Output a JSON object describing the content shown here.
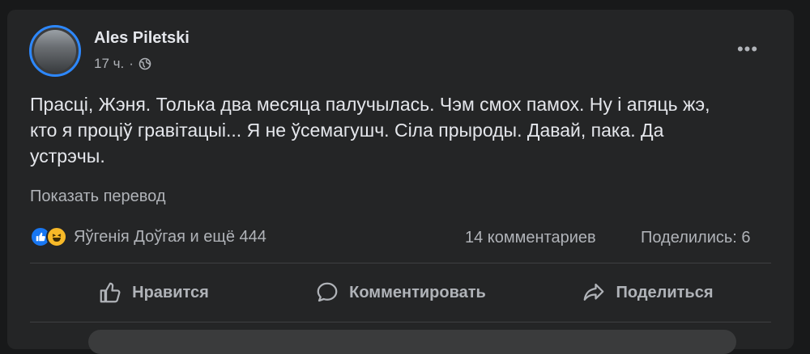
{
  "post": {
    "author": "Ales Piletski",
    "time": "17 ч.",
    "separator": "·",
    "more_label": "•••",
    "body": "Прасці, Жэня. Толька два месяца палучылась. Чэм смох памох. Ну і апяць жэ,\nкто я проціў гравітацыі... Я не ўсемагушч. Сіла прыроды. Давай, пака. Да\nустрэчы.",
    "translate_link": "Показать перевод"
  },
  "reactions": {
    "icons": [
      "like-icon",
      "haha-icon"
    ],
    "summary": "Яўгенія Доўгая и ещё 444",
    "comments": "14 комментариев",
    "shares": "Поделились: 6"
  },
  "actions": {
    "like": "Нравится",
    "comment": "Комментировать",
    "share": "Поделиться"
  },
  "colors": {
    "background": "#18191a",
    "card": "#242526",
    "primary_text": "#e4e6eb",
    "secondary_text": "#b0b3b8",
    "like_blue": "#1877f2",
    "haha_yellow": "#f7b928"
  }
}
